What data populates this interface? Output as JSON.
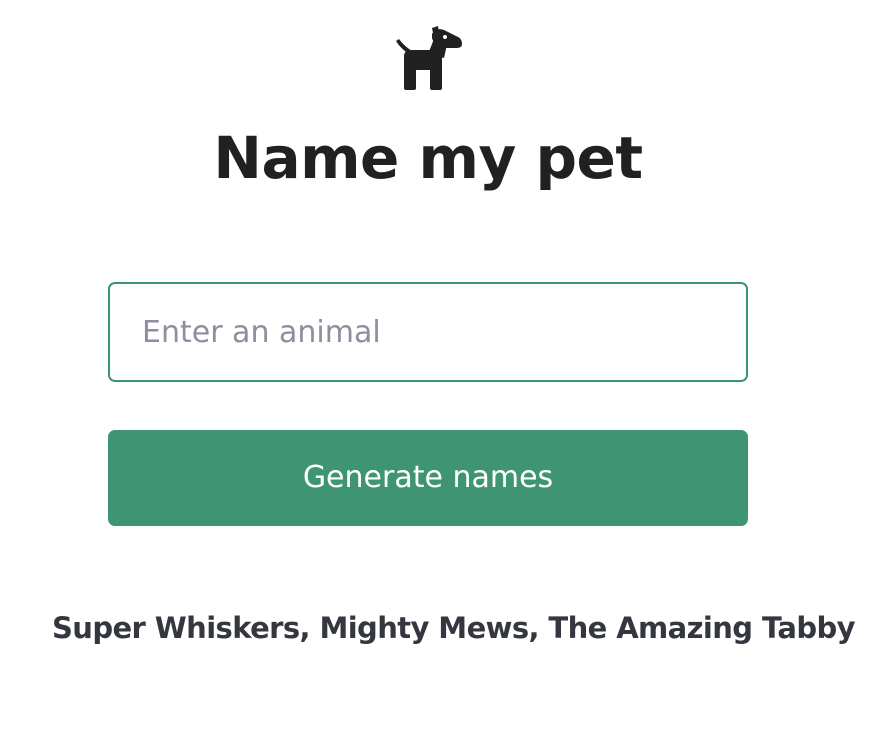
{
  "app": {
    "title": "Name my pet",
    "logo_icon": "dog-icon"
  },
  "form": {
    "animal_input": {
      "value": "",
      "placeholder": "Enter an animal"
    },
    "submit_label": "Generate names"
  },
  "result": {
    "text": "Super Whiskers, Mighty Mews, The Amazing Tabby"
  },
  "colors": {
    "accent": "#3f9474",
    "input_border": "#3e9373",
    "text": "#202123",
    "placeholder": "#8e8ea0"
  }
}
